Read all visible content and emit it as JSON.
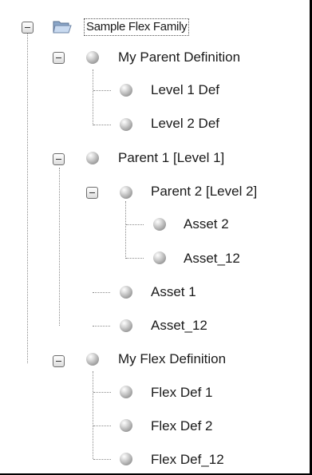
{
  "tree": {
    "root": {
      "label": "Sample Flex Family",
      "expanded": true,
      "icon": "open-folder-icon"
    },
    "nodes": [
      {
        "label": "My Parent Definition",
        "expanded": true,
        "icon": "sphere-icon"
      },
      {
        "label": "Level 1 Def",
        "icon": "sphere-icon"
      },
      {
        "label": "Level 2 Def",
        "icon": "sphere-icon"
      },
      {
        "label": "Parent 1 [Level 1]",
        "expanded": true,
        "icon": "sphere-icon"
      },
      {
        "label": "Parent 2 [Level 2]",
        "expanded": true,
        "icon": "sphere-icon"
      },
      {
        "label": "Asset 2",
        "icon": "sphere-icon"
      },
      {
        "label": "Asset_12",
        "icon": "sphere-icon"
      },
      {
        "label": "Asset 1",
        "icon": "sphere-icon"
      },
      {
        "label": "Asset_12",
        "icon": "sphere-icon"
      },
      {
        "label": "My Flex Definition",
        "expanded": true,
        "icon": "sphere-icon"
      },
      {
        "label": "Flex Def 1",
        "icon": "sphere-icon"
      },
      {
        "label": "Flex Def 2",
        "icon": "sphere-icon"
      },
      {
        "label": "Flex Def_12",
        "icon": "sphere-icon"
      }
    ]
  },
  "colors": {
    "text": "#1a1a1a",
    "connector": "#8a8a8a",
    "frame": "#000000"
  }
}
